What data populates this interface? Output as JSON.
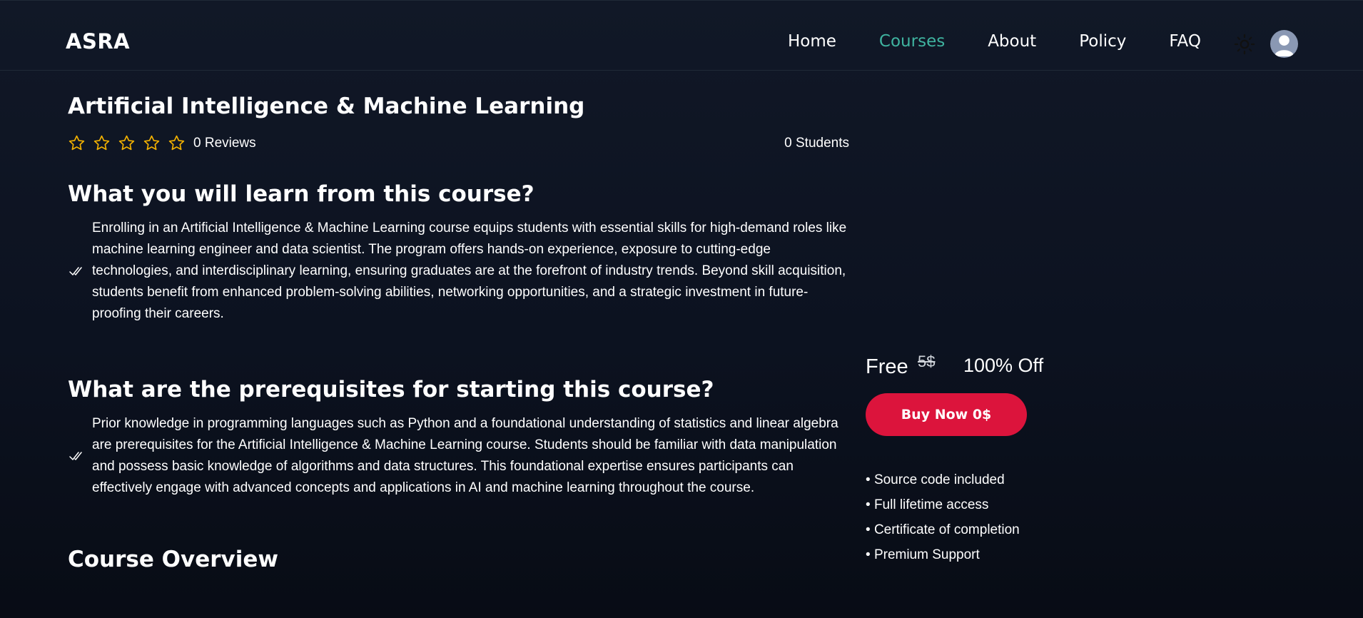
{
  "nav": {
    "brand": "ASRA",
    "links": [
      "Home",
      "Courses",
      "About",
      "Policy",
      "FAQ"
    ],
    "active_link": "Courses",
    "theme_icon": "sun-icon",
    "avatar_icon": "user-avatar-icon"
  },
  "course": {
    "title": "Artificial Intelligence & Machine Learning",
    "rating": 0,
    "rating_max": 5,
    "reviews_label": "0 Reviews",
    "students_label": "0 Students"
  },
  "sections": {
    "learn": {
      "heading": "What you will learn from this course?",
      "text": "Enrolling in an Artificial Intelligence & Machine Learning course equips students with essential skills for high-demand roles like machine learning engineer and data scientist. The program offers hands-on experience, exposure to cutting-edge technologies, and interdisciplinary learning, ensuring graduates are at the forefront of industry trends. Beyond skill acquisition, students benefit from enhanced problem-solving abilities, networking opportunities, and a strategic investment in future-proofing their careers."
    },
    "prereq": {
      "heading": "What are the prerequisites for starting this course?",
      "text": "Prior knowledge in programming languages such as Python and a foundational understanding of statistics and linear algebra are prerequisites for the Artificial Intelligence & Machine Learning course. Students should be familiar with data manipulation and possess basic knowledge of algorithms and data structures. This foundational expertise ensures participants can effectively engage with advanced concepts and applications in AI and machine learning throughout the course."
    },
    "overview": {
      "heading": "Course Overview"
    }
  },
  "pricing": {
    "price": "Free",
    "original_price": "5$",
    "discount": "100% Off",
    "buy_label": "Buy Now 0$",
    "features": [
      "Source code included",
      "Full lifetime access",
      "Certificate of completion",
      "Premium Support"
    ]
  },
  "colors": {
    "background": "#0c1220",
    "accent": "#3fb4a0",
    "button": "#dc143c",
    "star": "#f5b301"
  }
}
